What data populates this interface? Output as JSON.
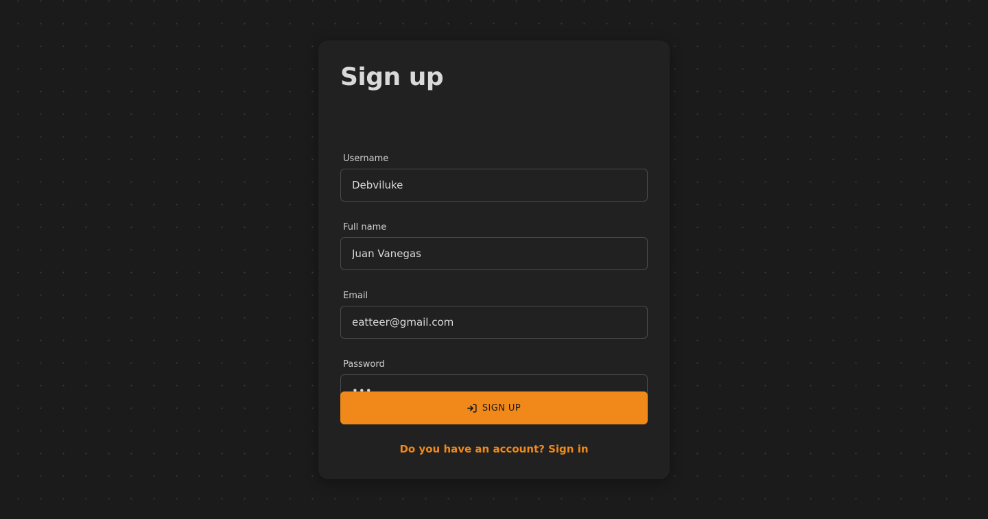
{
  "form": {
    "title": "Sign up",
    "fields": [
      {
        "label": "Username",
        "value": "Debviluke",
        "type": "text"
      },
      {
        "label": "Full name",
        "value": "Juan Vanegas",
        "type": "text"
      },
      {
        "label": "Email",
        "value": "eatteer@gmail.com",
        "type": "email"
      },
      {
        "label": "Password",
        "value": "•••",
        "type": "password"
      }
    ],
    "submit_label": "SIGN UP",
    "submit_icon": "sign-in-icon",
    "signin_link": "Do you have an account? Sign in"
  },
  "colors": {
    "background": "#1b1b1b",
    "card": "#212121",
    "accent": "#f0891a",
    "text": "#d8d8d8"
  }
}
